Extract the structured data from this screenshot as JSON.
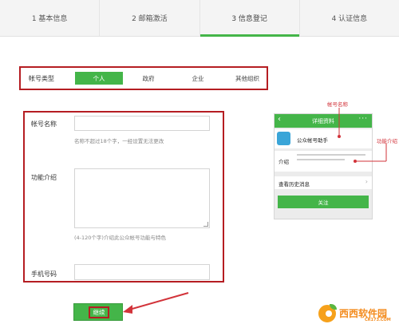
{
  "steps": [
    {
      "label": "1 基本信息"
    },
    {
      "label": "2 邮箱激活"
    },
    {
      "label": "3 信息登记"
    },
    {
      "label": "4 认证信息"
    }
  ],
  "account_type": {
    "label": "帐号类型",
    "options": [
      "个人",
      "政府",
      "企业",
      "其他组织"
    ],
    "selected": "个人"
  },
  "form": {
    "name_label": "帐号名称",
    "name_value": "",
    "name_hint": "名称不超过18个字，一经设置无法更改",
    "intro_label": "功能介绍",
    "intro_value": "",
    "intro_hint": "(4-120个字)介绍此公众帐号功能与特色",
    "phone_label": "手机号码",
    "phone_value": ""
  },
  "continue_label": "继续",
  "preview": {
    "title": "详细资料",
    "account_name": "公众帐号助手",
    "intro_label": "介绍",
    "history_label": "查看历史消息",
    "follow_label": "关注"
  },
  "annotations": {
    "name": "帐号名称",
    "intro": "功能介绍"
  },
  "watermark": {
    "brand": "西西软件园",
    "domain": "CR173.COM"
  },
  "colors": {
    "accent": "#44b549",
    "highlight": "#b51d22",
    "annotation": "#d2333a"
  }
}
